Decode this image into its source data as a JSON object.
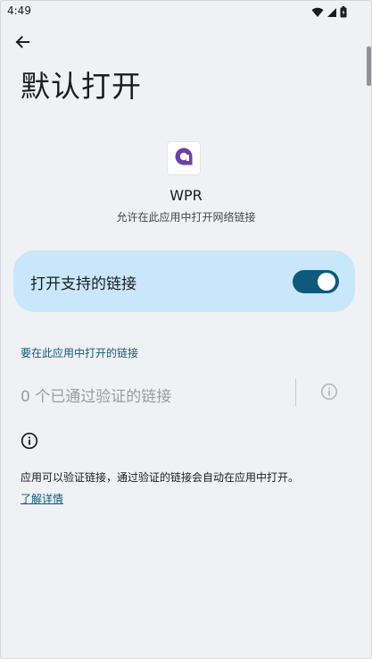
{
  "status_bar": {
    "time": "4:49",
    "icons": [
      "wifi-icon",
      "signal-icon",
      "battery-icon"
    ]
  },
  "header": {
    "back_icon": "arrow-back-icon",
    "title": "默认打开"
  },
  "app": {
    "icon": "app-logo-icon",
    "name": "WPR",
    "summary": "允许在此应用中打开网络链接"
  },
  "toggle": {
    "label": "打开支持的链接",
    "checked": true
  },
  "links_section": {
    "header": "要在此应用中打开的链接",
    "verified_count_text": "0 个已通过验证的链接",
    "info_icon": "info-icon"
  },
  "footer": {
    "info_icon": "info-icon",
    "text": "应用可以验证链接，通过验证的链接会自动在应用中打开。",
    "learn_more": "了解详情"
  },
  "colors": {
    "background": "#eff1f4",
    "card": "#c9e7fb",
    "accent": "#0f5a7c",
    "app_logo": "#6c3fa8",
    "muted_text": "#9a9ca0"
  }
}
